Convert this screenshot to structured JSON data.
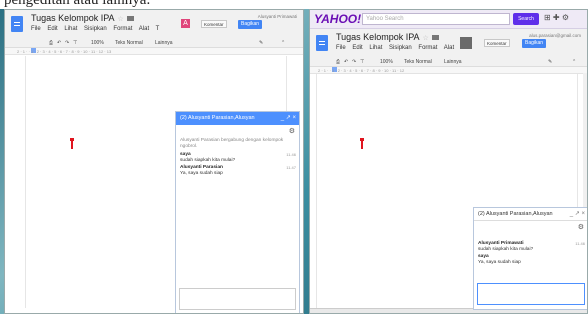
{
  "caption": "pengeditan atau lainnya.",
  "left_window": {
    "doc_title": "Tugas Kelompok IPA",
    "menus": [
      "File",
      "Edit",
      "Lihat",
      "Sisipkan",
      "Format",
      "Alat",
      "T"
    ],
    "user": "Alusyanti Primawati",
    "avatar_letter": "A",
    "comment_label": "Komentar",
    "share_label": "Bagikan",
    "toolbar": {
      "zoom": "100%",
      "style": "Teks Normal",
      "font": "Lainnya"
    },
    "chat": {
      "title": "(2) Alusyanti Parasian,Alusyan",
      "system": "Alusyanti Parasian bergabung dengan kelompok ngobrol.",
      "messages": [
        {
          "sender": "saya",
          "text": "sudah siapkah kita mulai?",
          "time": "11.46"
        },
        {
          "sender": "Alusyanti Parasian",
          "text": "Ya, saya sudah siap",
          "time": "11.47"
        }
      ]
    }
  },
  "right_window": {
    "yahoo_logo": "YAHOO!",
    "yahoo_search_placeholder": "Yahoo Search",
    "yahoo_search_btn": "Search",
    "doc_title": "Tugas Kelompok IPA",
    "menus": [
      "File",
      "Edit",
      "Lihat",
      "Sisipkan",
      "Format",
      "Alat",
      "Ta"
    ],
    "user": "alus.parasian@gmail.com",
    "comment_label": "Komentar",
    "share_label": "Bagikan",
    "toolbar": {
      "zoom": "100%",
      "style": "Teks Normal",
      "font": "Lainnya"
    },
    "chat": {
      "title": "(2) Alusyanti Parasian,Alusyan",
      "messages": [
        {
          "sender": "Alusyanti Primawati",
          "text": "sudah siapkah kita mulai?",
          "time": "11.46"
        },
        {
          "sender": "saya",
          "text": "Ya, saya sudah siap",
          "time": ""
        }
      ]
    }
  },
  "colors": {
    "chat_header": "#4d90fe",
    "doc_icon": "#4285f4",
    "cursor": "#e0141e",
    "yahoo": "#6b0fb5"
  },
  "icons": [
    "doc-icon",
    "star-icon",
    "folder-icon",
    "print-icon",
    "undo-icon",
    "redo-icon",
    "paint-format-icon",
    "pen-icon",
    "collapse-icon",
    "gear-icon",
    "minimize-icon",
    "popout-icon",
    "close-icon"
  ]
}
